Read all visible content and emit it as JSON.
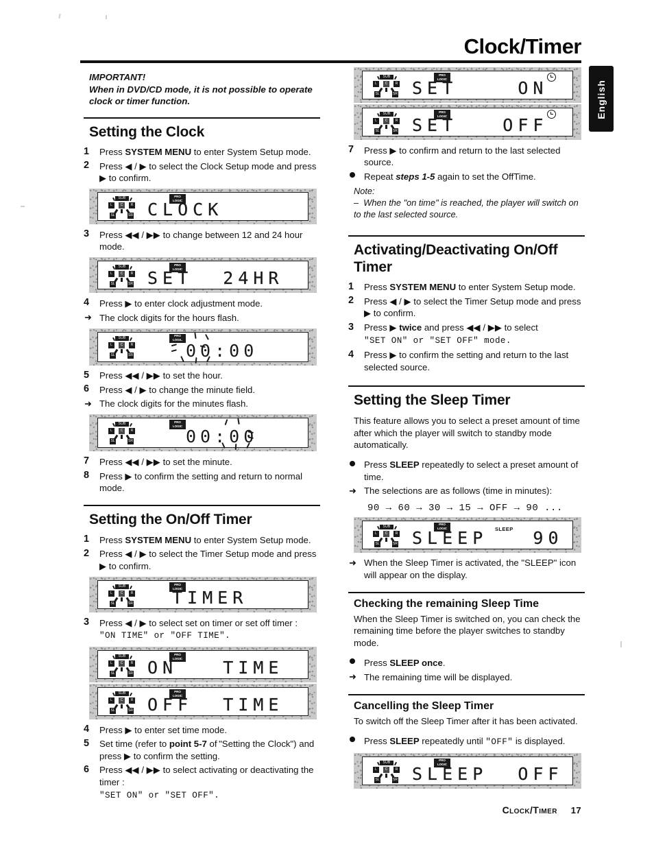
{
  "header": {
    "title": "Clock/Timer",
    "language_tab": "English"
  },
  "footer": {
    "section": "Clock/Timer",
    "page_number": "17"
  },
  "left_column": {
    "important": {
      "heading": "IMPORTANT!",
      "text": "When in DVD/CD mode, it is not possible to operate clock or timer function."
    },
    "setting_the_clock": {
      "heading": "Setting the Clock",
      "steps": [
        {
          "num": "1",
          "text": "Press SYSTEM MENU to enter System Setup mode.",
          "bold_part": "SYSTEM MENU"
        },
        {
          "num": "2",
          "text": "Press ◀ / ▶ to select the Clock Setup mode and press ▶ to confirm."
        },
        {
          "num": "3",
          "text": "Press ◀◀ / ▶▶ to change between 12 and 24 hour mode."
        },
        {
          "num": "4",
          "text": "Press ▶ to enter clock adjustment mode."
        },
        {
          "num": "5",
          "text": "Press ◀◀ / ▶▶ to set the hour."
        },
        {
          "num": "6",
          "text": "Press ◀ / ▶ to change the minute field."
        },
        {
          "num": "7",
          "text": "Press ◀◀ / ▶▶ to set the minute."
        },
        {
          "num": "8",
          "text": "Press ▶ to confirm the setting and return to normal mode."
        }
      ],
      "result_hours": "The clock digits for the hours flash.",
      "result_minutes": "The clock digits for the minutes flash.",
      "display_clock": "CLOCK",
      "display_set24hr": "SET  24HR",
      "display_hours_flash": "00:00",
      "display_minutes_flash": "00:00"
    },
    "setting_onoff_timer": {
      "heading": "Setting the On/Off Timer",
      "steps": [
        {
          "num": "1",
          "text": "Press SYSTEM MENU to enter System Setup mode.",
          "bold_part": "SYSTEM MENU"
        },
        {
          "num": "2",
          "text": "Press ◀ / ▶ to select the Timer Setup mode and press ▶ to confirm."
        },
        {
          "num": "3",
          "text": "Press ◀ / ▶ to select set on timer or set off timer :"
        },
        {
          "num": "4",
          "text": "Press ▶ to enter set time mode."
        },
        {
          "num": "5",
          "text": "Set time (refer to point 5-7 of \"Setting the Clock\") and press ▶ to confirm the setting."
        },
        {
          "num": "6",
          "text": "Press ◀◀ / ▶▶ to select activating or deactivating the timer :"
        }
      ],
      "step3_modes": "\"ON TIME\" or \"OFF TIME\".",
      "step6_modes": "\"SET ON\" or \"SET OFF\".",
      "display_timer": "TIMER",
      "display_on_time": "ON   TIME",
      "display_off_time": "OFF  TIME"
    }
  },
  "right_column": {
    "top_displays": {
      "display_set_on": "SET    ON",
      "display_set_off": "SET   OFF"
    },
    "continued_steps": [
      {
        "num": "7",
        "text": "Press ▶ to confirm and return to the last selected source."
      },
      {
        "bullet": true,
        "text": "Repeat steps 1-5 again to set the OffTime.",
        "bold_italic_part": "steps 1-5"
      }
    ],
    "note": {
      "heading": "Note:",
      "text": "When the \"on time\" is reached, the player will switch on to the last selected source."
    },
    "activating_deactivating": {
      "heading": "Activating/Deactivating On/Off Timer",
      "steps": [
        {
          "num": "1",
          "text": "Press SYSTEM MENU to enter System Setup mode.",
          "bold_part": "SYSTEM MENU"
        },
        {
          "num": "2",
          "text": "Press ◀ / ▶ to select the Timer Setup mode and press ▶ to confirm."
        },
        {
          "num": "3",
          "text": "Press ▶ twice and press ◀◀ / ▶▶ to select"
        },
        {
          "num": "4",
          "text": "Press ▶ to confirm the setting and return to the last selected source."
        }
      ],
      "step3_modes": "\"SET ON\" or \"SET OFF\" mode."
    },
    "setting_sleep_timer": {
      "heading": "Setting the Sleep Timer",
      "intro": "This feature allows you to select a preset amount of time after which the player will switch to standby mode automatically.",
      "bullet": "Press SLEEP repeatedly to select a preset amount of time.",
      "bullet_bold": "SLEEP",
      "result": "The selections are as follows (time in minutes):",
      "sequence": "90 → 60 → 30 →  15 → OFF → 90 ...",
      "display_sleep_90": "SLEEP   90",
      "sleep_indicator": "SLEEP",
      "result2": "When the Sleep Timer is activated, the \"SLEEP\" icon will appear on the display."
    },
    "checking_remaining": {
      "heading": "Checking the remaining Sleep Time",
      "text": "When the Sleep Timer is switched on, you can check the remaining time before the player switches to standby mode.",
      "bullet": "Press SLEEP once.",
      "bullet_bold": "SLEEP once",
      "result": "The remaining time will be displayed."
    },
    "cancelling": {
      "heading": "Cancelling the Sleep Timer",
      "text": "To switch off the Sleep Timer after it has been activated.",
      "bullet": "Press SLEEP repeatedly until \"OFF\" is displayed.",
      "bullet_bold": "SLEEP",
      "display_sleep_off": "SLEEP  OFF"
    }
  },
  "lcd_icons": {
    "sub": "SUB",
    "left": "L",
    "center": "C",
    "right": "R",
    "surround_left": "SL",
    "surround_right": "SR",
    "pro_logic_line1": "PRO",
    "pro_logic_line2": "LOGIC"
  }
}
